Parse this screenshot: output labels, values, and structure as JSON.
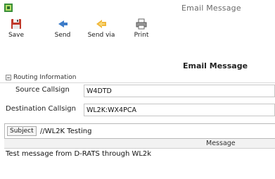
{
  "window": {
    "title": "Email Message",
    "icon": "app-icon"
  },
  "toolbar": {
    "buttons": [
      {
        "label": "Save",
        "icon": "floppy-save-icon"
      },
      {
        "label": "Send",
        "icon": "send-arrow-icon"
      },
      {
        "label": "Send via",
        "icon": "send-via-icon"
      },
      {
        "label": "Print",
        "icon": "printer-icon"
      }
    ]
  },
  "header": {
    "title": "Email Message"
  },
  "routing": {
    "section_label": "Routing Information",
    "source_label": "Source Callsign",
    "source_value": "W4DTD",
    "dest_label": "Destination Callsign",
    "dest_value": "WL2K:WX4PCA"
  },
  "subject": {
    "label": "Subject",
    "value": "//WL2K Testing"
  },
  "message": {
    "column_header": "Message",
    "body": "Test message from D-RATS through WL2k"
  },
  "colors": {
    "accent_red": "#d33a2c",
    "accent_blue": "#2f6db5",
    "accent_yellow": "#e8b53a"
  }
}
